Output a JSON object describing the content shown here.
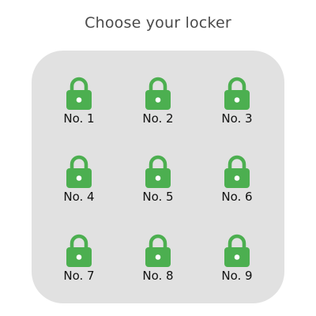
{
  "title": "Choose your locker",
  "colors": {
    "lock_green": "#4caf50",
    "panel_bg": "#e1e1e1",
    "keyhole": "#ffffff"
  },
  "lockers": [
    {
      "label": "No. 1",
      "icon": "lock-icon",
      "state": "locked"
    },
    {
      "label": "No. 2",
      "icon": "lock-icon",
      "state": "locked"
    },
    {
      "label": "No. 3",
      "icon": "lock-icon",
      "state": "locked"
    },
    {
      "label": "No. 4",
      "icon": "lock-icon",
      "state": "locked"
    },
    {
      "label": "No. 5",
      "icon": "lock-icon",
      "state": "locked"
    },
    {
      "label": "No. 6",
      "icon": "lock-icon",
      "state": "locked"
    },
    {
      "label": "No. 7",
      "icon": "lock-icon",
      "state": "locked"
    },
    {
      "label": "No. 8",
      "icon": "lock-icon",
      "state": "locked"
    },
    {
      "label": "No. 9",
      "icon": "lock-icon",
      "state": "locked"
    }
  ]
}
